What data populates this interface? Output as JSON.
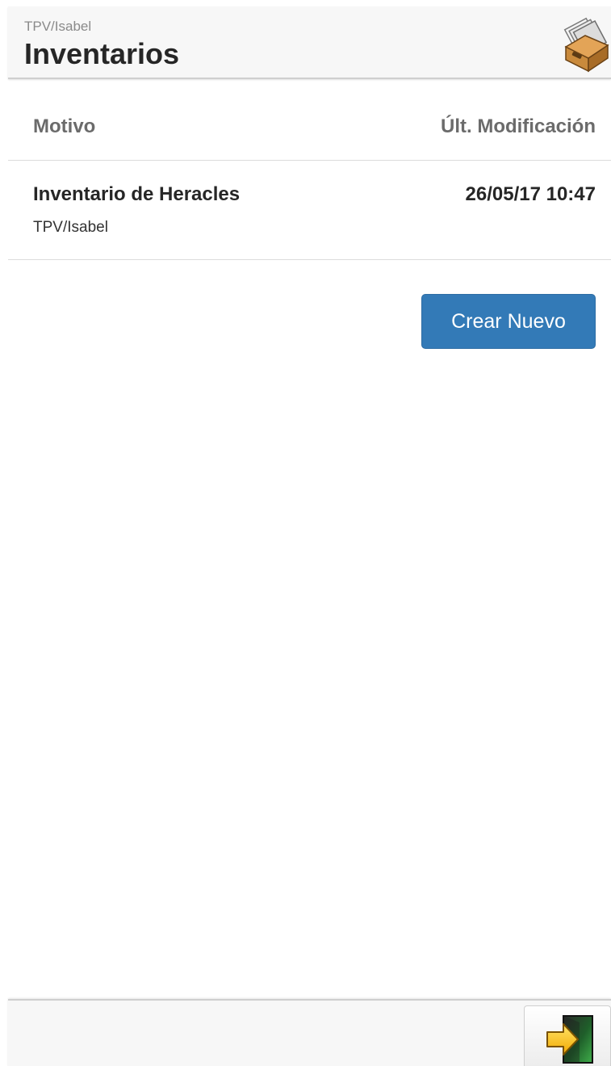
{
  "header": {
    "subtitle": "TPV/Isabel",
    "title": "Inventarios",
    "icon": "inventory-box-icon"
  },
  "table": {
    "columns": {
      "motivo": "Motivo",
      "modified": "Últ. Modificación"
    },
    "rows": [
      {
        "name": "Inventario de Heracles",
        "sub": "TPV/Isabel",
        "date": "26/05/17 10:47"
      }
    ]
  },
  "actions": {
    "create_label": "Crear Nuevo"
  },
  "footer": {
    "exit_icon": "exit-door-icon"
  },
  "colors": {
    "primary_button": "#337ab7",
    "header_bg": "#f7f7f7"
  }
}
